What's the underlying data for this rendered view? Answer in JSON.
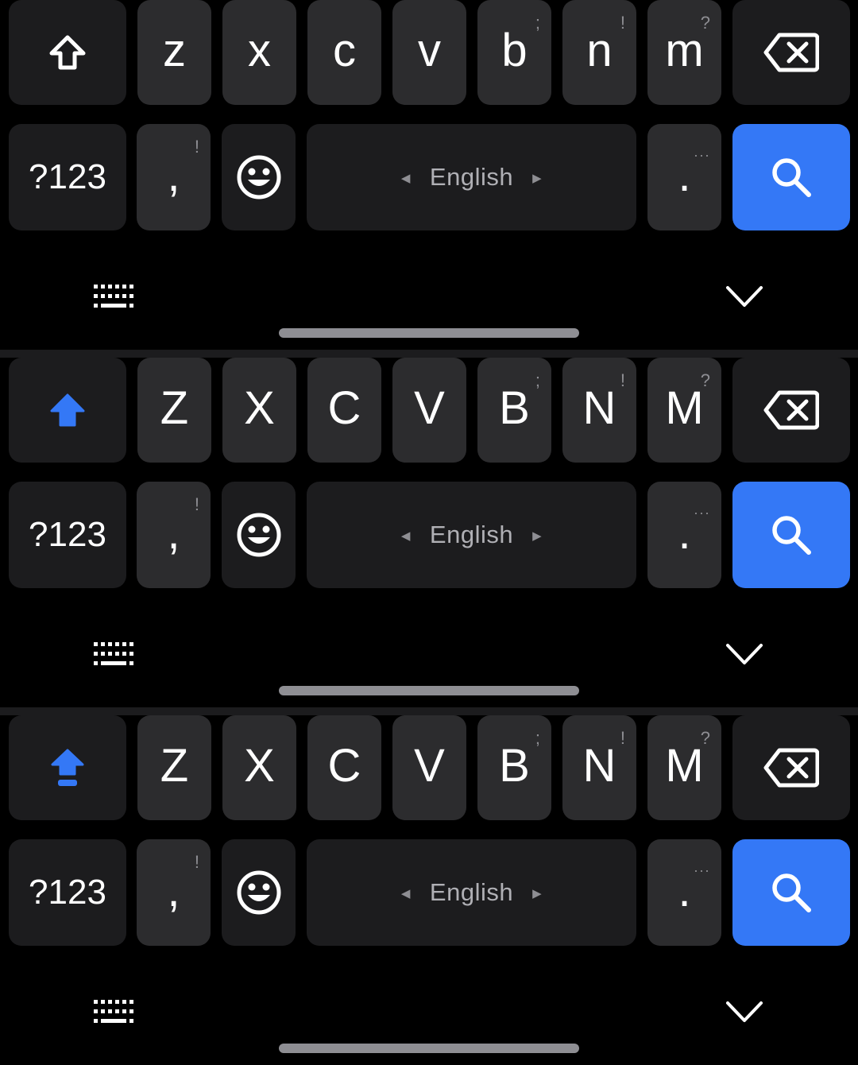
{
  "keyboards": [
    {
      "shift_state": "off",
      "letters": [
        {
          "label": "z",
          "hint": ""
        },
        {
          "label": "x",
          "hint": ""
        },
        {
          "label": "c",
          "hint": ""
        },
        {
          "label": "v",
          "hint": ""
        },
        {
          "label": "b",
          "hint": ";"
        },
        {
          "label": "n",
          "hint": "!"
        },
        {
          "label": "m",
          "hint": "?"
        }
      ],
      "sym_label": "?123",
      "comma": {
        "label": ",",
        "hint": "!"
      },
      "space_label": "English",
      "period": {
        "label": ".",
        "hint": "···"
      }
    },
    {
      "shift_state": "shift",
      "letters": [
        {
          "label": "Z",
          "hint": ""
        },
        {
          "label": "X",
          "hint": ""
        },
        {
          "label": "C",
          "hint": ""
        },
        {
          "label": "V",
          "hint": ""
        },
        {
          "label": "B",
          "hint": ";"
        },
        {
          "label": "N",
          "hint": "!"
        },
        {
          "label": "M",
          "hint": "?"
        }
      ],
      "sym_label": "?123",
      "comma": {
        "label": ",",
        "hint": "!"
      },
      "space_label": "English",
      "period": {
        "label": ".",
        "hint": "···"
      }
    },
    {
      "shift_state": "caps-lock",
      "letters": [
        {
          "label": "Z",
          "hint": ""
        },
        {
          "label": "X",
          "hint": ""
        },
        {
          "label": "C",
          "hint": ""
        },
        {
          "label": "V",
          "hint": ""
        },
        {
          "label": "B",
          "hint": ";"
        },
        {
          "label": "N",
          "hint": "!"
        },
        {
          "label": "M",
          "hint": "?"
        }
      ],
      "sym_label": "?123",
      "comma": {
        "label": ",",
        "hint": "!"
      },
      "space_label": "English",
      "period": {
        "label": ".",
        "hint": "···"
      }
    }
  ],
  "space_arrows": {
    "left": "◀",
    "right": "▶"
  },
  "colors": {
    "background": "#000000",
    "letter_key": "#2c2c2e",
    "function_key": "#1c1c1e",
    "accent": "#3478f6",
    "text": "#ffffff",
    "hint_text": "#8e8e93"
  },
  "icons": {
    "shift_off": "shift-outline-icon",
    "shift_on": "shift-filled-icon",
    "caps_lock": "caps-lock-icon",
    "backspace": "backspace-icon",
    "emoji": "smiley-icon",
    "search": "search-icon",
    "keyboard_switch": "keyboard-icon",
    "hide_keyboard": "chevron-down-icon"
  }
}
